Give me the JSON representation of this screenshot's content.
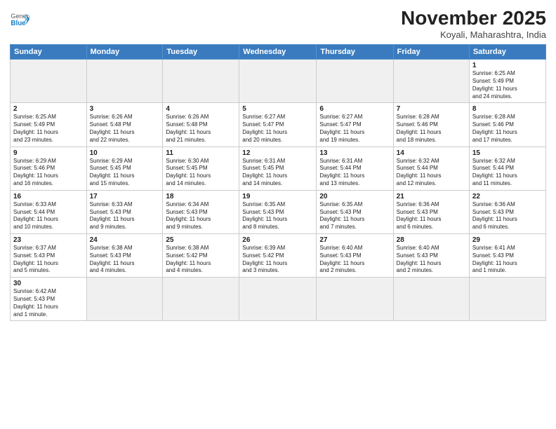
{
  "header": {
    "logo_general": "General",
    "logo_blue": "Blue",
    "month_title": "November 2025",
    "location": "Koyali, Maharashtra, India"
  },
  "weekdays": [
    "Sunday",
    "Monday",
    "Tuesday",
    "Wednesday",
    "Thursday",
    "Friday",
    "Saturday"
  ],
  "weeks": [
    [
      {
        "day": "",
        "info": ""
      },
      {
        "day": "",
        "info": ""
      },
      {
        "day": "",
        "info": ""
      },
      {
        "day": "",
        "info": ""
      },
      {
        "day": "",
        "info": ""
      },
      {
        "day": "",
        "info": ""
      },
      {
        "day": "1",
        "info": "Sunrise: 6:25 AM\nSunset: 5:49 PM\nDaylight: 11 hours\nand 24 minutes."
      }
    ],
    [
      {
        "day": "2",
        "info": "Sunrise: 6:25 AM\nSunset: 5:49 PM\nDaylight: 11 hours\nand 23 minutes."
      },
      {
        "day": "3",
        "info": "Sunrise: 6:26 AM\nSunset: 5:48 PM\nDaylight: 11 hours\nand 22 minutes."
      },
      {
        "day": "4",
        "info": "Sunrise: 6:26 AM\nSunset: 5:48 PM\nDaylight: 11 hours\nand 21 minutes."
      },
      {
        "day": "5",
        "info": "Sunrise: 6:27 AM\nSunset: 5:47 PM\nDaylight: 11 hours\nand 20 minutes."
      },
      {
        "day": "6",
        "info": "Sunrise: 6:27 AM\nSunset: 5:47 PM\nDaylight: 11 hours\nand 19 minutes."
      },
      {
        "day": "7",
        "info": "Sunrise: 6:28 AM\nSunset: 5:46 PM\nDaylight: 11 hours\nand 18 minutes."
      },
      {
        "day": "8",
        "info": "Sunrise: 6:28 AM\nSunset: 5:46 PM\nDaylight: 11 hours\nand 17 minutes."
      }
    ],
    [
      {
        "day": "9",
        "info": "Sunrise: 6:29 AM\nSunset: 5:46 PM\nDaylight: 11 hours\nand 16 minutes."
      },
      {
        "day": "10",
        "info": "Sunrise: 6:29 AM\nSunset: 5:45 PM\nDaylight: 11 hours\nand 15 minutes."
      },
      {
        "day": "11",
        "info": "Sunrise: 6:30 AM\nSunset: 5:45 PM\nDaylight: 11 hours\nand 14 minutes."
      },
      {
        "day": "12",
        "info": "Sunrise: 6:31 AM\nSunset: 5:45 PM\nDaylight: 11 hours\nand 14 minutes."
      },
      {
        "day": "13",
        "info": "Sunrise: 6:31 AM\nSunset: 5:44 PM\nDaylight: 11 hours\nand 13 minutes."
      },
      {
        "day": "14",
        "info": "Sunrise: 6:32 AM\nSunset: 5:44 PM\nDaylight: 11 hours\nand 12 minutes."
      },
      {
        "day": "15",
        "info": "Sunrise: 6:32 AM\nSunset: 5:44 PM\nDaylight: 11 hours\nand 11 minutes."
      }
    ],
    [
      {
        "day": "16",
        "info": "Sunrise: 6:33 AM\nSunset: 5:44 PM\nDaylight: 11 hours\nand 10 minutes."
      },
      {
        "day": "17",
        "info": "Sunrise: 6:33 AM\nSunset: 5:43 PM\nDaylight: 11 hours\nand 9 minutes."
      },
      {
        "day": "18",
        "info": "Sunrise: 6:34 AM\nSunset: 5:43 PM\nDaylight: 11 hours\nand 9 minutes."
      },
      {
        "day": "19",
        "info": "Sunrise: 6:35 AM\nSunset: 5:43 PM\nDaylight: 11 hours\nand 8 minutes."
      },
      {
        "day": "20",
        "info": "Sunrise: 6:35 AM\nSunset: 5:43 PM\nDaylight: 11 hours\nand 7 minutes."
      },
      {
        "day": "21",
        "info": "Sunrise: 6:36 AM\nSunset: 5:43 PM\nDaylight: 11 hours\nand 6 minutes."
      },
      {
        "day": "22",
        "info": "Sunrise: 6:36 AM\nSunset: 5:43 PM\nDaylight: 11 hours\nand 6 minutes."
      }
    ],
    [
      {
        "day": "23",
        "info": "Sunrise: 6:37 AM\nSunset: 5:43 PM\nDaylight: 11 hours\nand 5 minutes."
      },
      {
        "day": "24",
        "info": "Sunrise: 6:38 AM\nSunset: 5:43 PM\nDaylight: 11 hours\nand 4 minutes."
      },
      {
        "day": "25",
        "info": "Sunrise: 6:38 AM\nSunset: 5:42 PM\nDaylight: 11 hours\nand 4 minutes."
      },
      {
        "day": "26",
        "info": "Sunrise: 6:39 AM\nSunset: 5:42 PM\nDaylight: 11 hours\nand 3 minutes."
      },
      {
        "day": "27",
        "info": "Sunrise: 6:40 AM\nSunset: 5:43 PM\nDaylight: 11 hours\nand 2 minutes."
      },
      {
        "day": "28",
        "info": "Sunrise: 6:40 AM\nSunset: 5:43 PM\nDaylight: 11 hours\nand 2 minutes."
      },
      {
        "day": "29",
        "info": "Sunrise: 6:41 AM\nSunset: 5:43 PM\nDaylight: 11 hours\nand 1 minute."
      }
    ],
    [
      {
        "day": "30",
        "info": "Sunrise: 6:42 AM\nSunset: 5:43 PM\nDaylight: 11 hours\nand 1 minute."
      },
      {
        "day": "",
        "info": ""
      },
      {
        "day": "",
        "info": ""
      },
      {
        "day": "",
        "info": ""
      },
      {
        "day": "",
        "info": ""
      },
      {
        "day": "",
        "info": ""
      },
      {
        "day": "",
        "info": ""
      }
    ]
  ]
}
